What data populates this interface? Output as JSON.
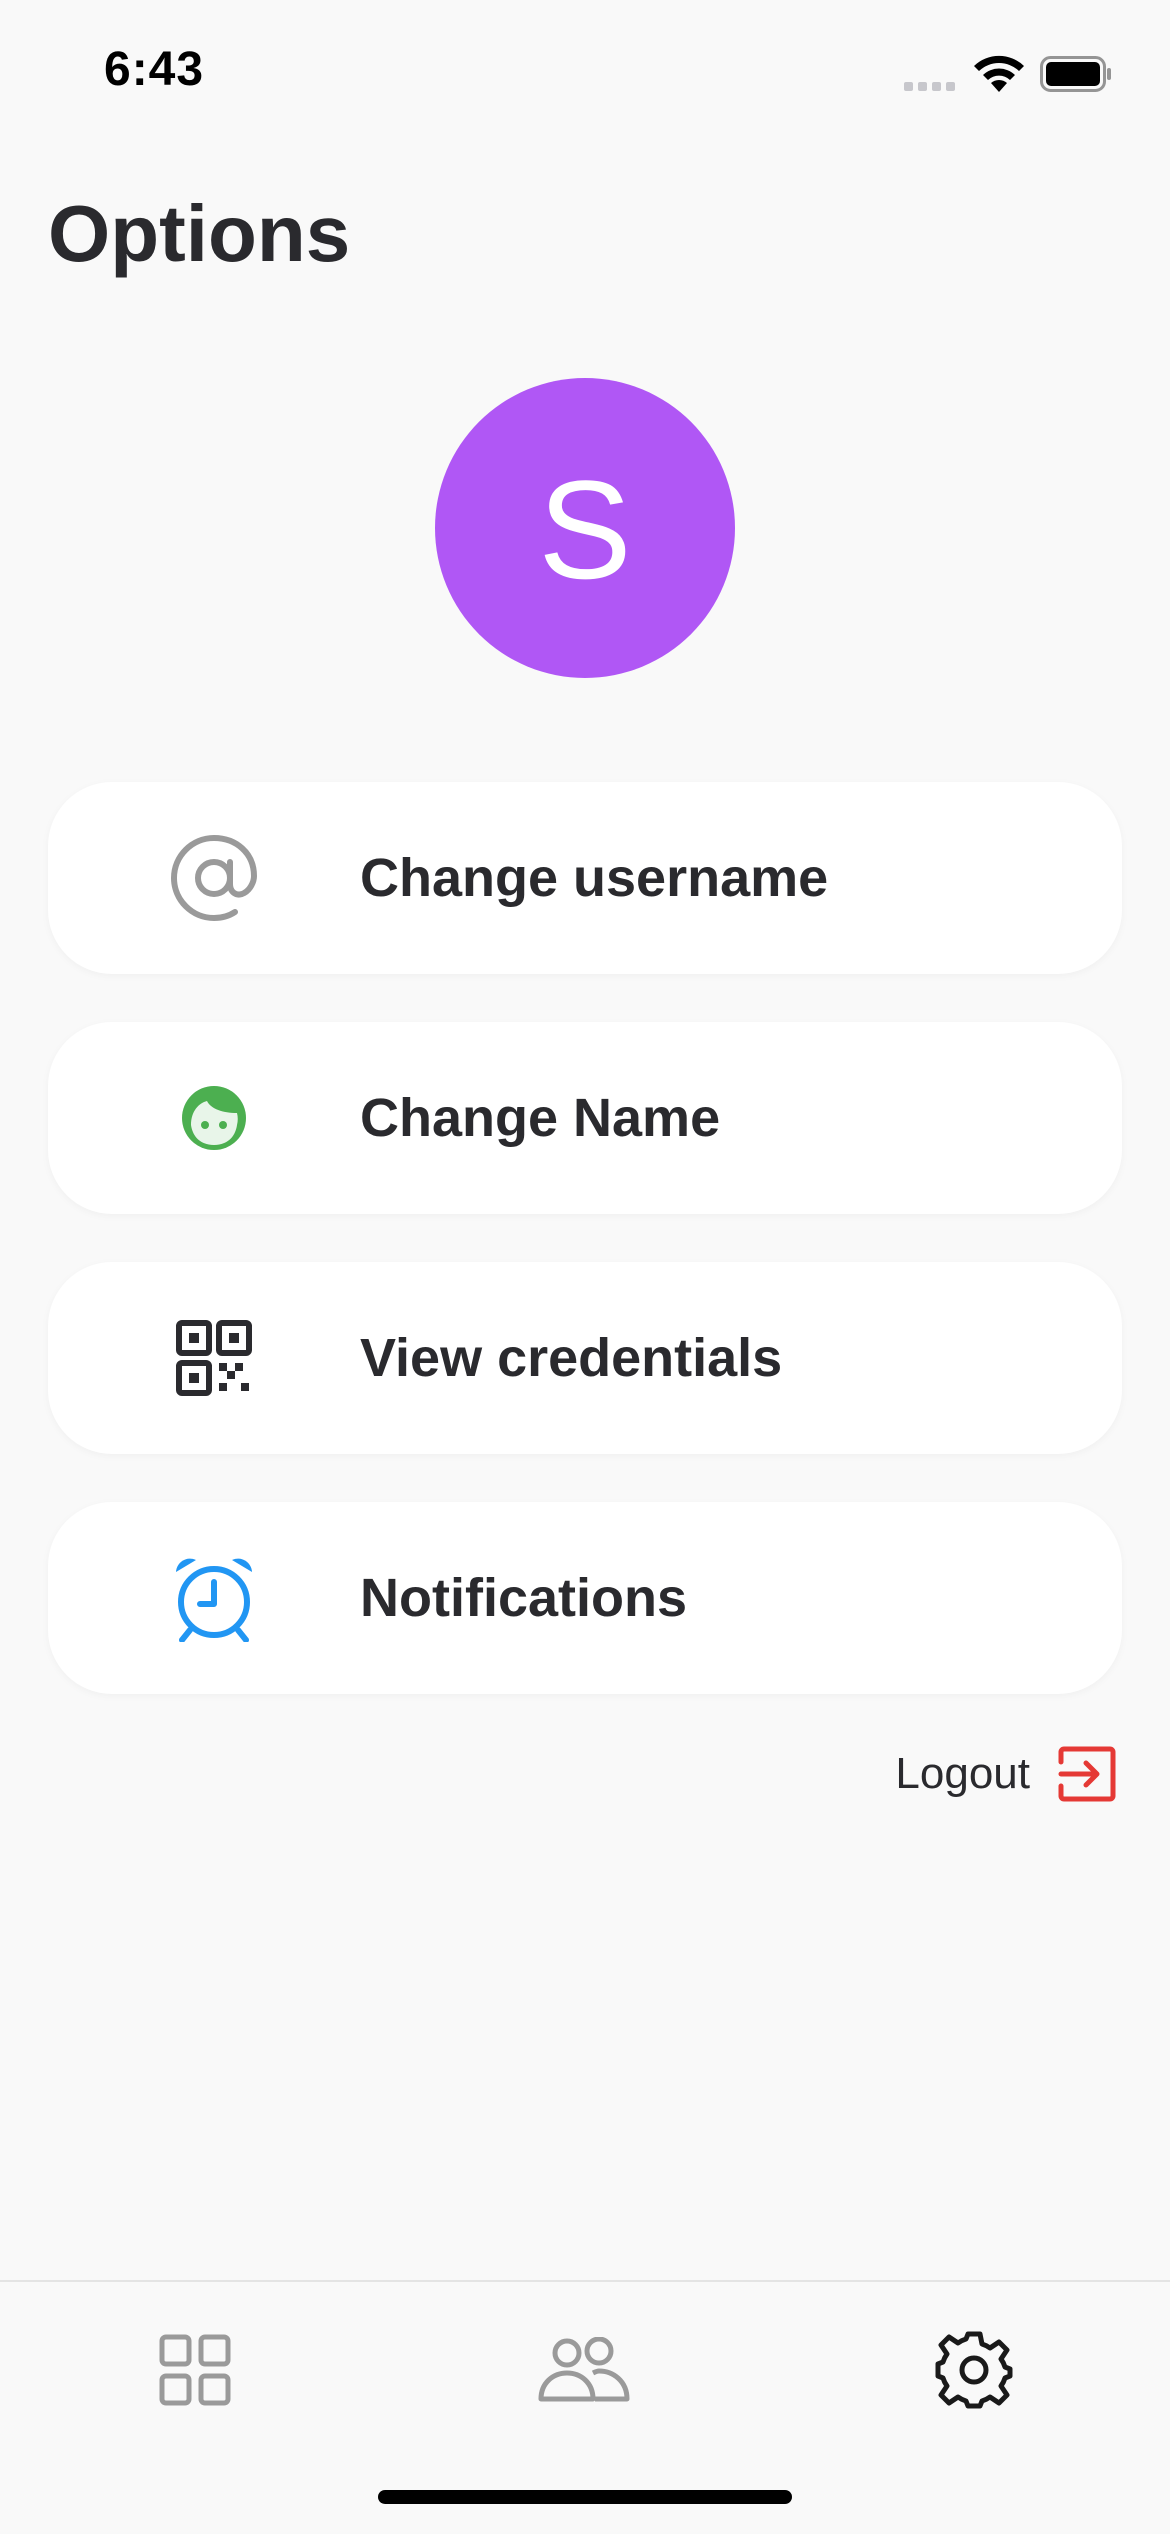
{
  "status_bar": {
    "time": "6:43"
  },
  "header": {
    "title": "Options"
  },
  "profile": {
    "avatar_initial": "S",
    "avatar_color": "#b057f5"
  },
  "options": [
    {
      "label": "Change username",
      "icon": "at-sign-icon",
      "icon_color": "#9a9a9a"
    },
    {
      "label": "Change Name",
      "icon": "face-icon",
      "icon_color": "#4caf50"
    },
    {
      "label": "View credentials",
      "icon": "qr-code-icon",
      "icon_color": "#2a2a2e"
    },
    {
      "label": "Notifications",
      "icon": "alarm-clock-icon",
      "icon_color": "#2196f3"
    }
  ],
  "logout": {
    "label": "Logout",
    "icon": "logout-icon",
    "icon_color": "#e53935"
  },
  "tab_bar": {
    "tabs": [
      {
        "name": "dashboard",
        "icon": "grid-icon",
        "active": false
      },
      {
        "name": "people",
        "icon": "people-icon",
        "active": false
      },
      {
        "name": "settings",
        "icon": "gear-icon",
        "active": true
      }
    ]
  }
}
